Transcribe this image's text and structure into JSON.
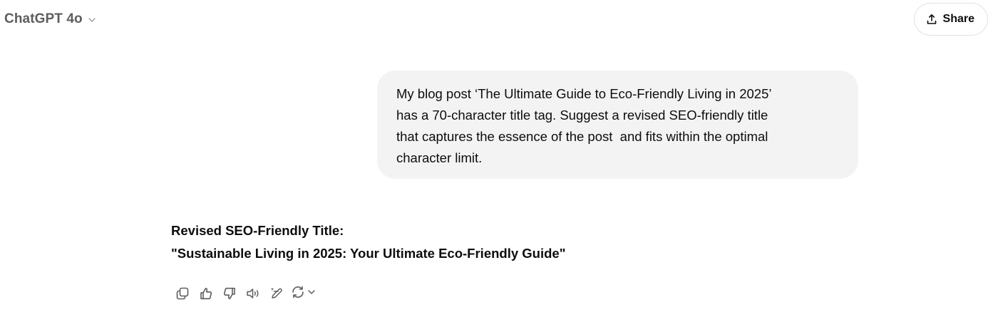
{
  "header": {
    "model_name": "ChatGPT 4o",
    "share_label": "Share"
  },
  "conversation": {
    "user_message": "My blog post ‘The Ultimate Guide to Eco-Friendly Living in 2025’\nhas a 70-character title tag. Suggest a revised SEO-friendly title\nthat captures the essence of the post  and fits within the optimal\ncharacter limit.",
    "assistant": {
      "heading": "Revised SEO-Friendly Title:",
      "title": "\"Sustainable Living in 2025: Your Ultimate Eco-Friendly Guide\""
    }
  },
  "actions": {
    "icons": [
      "copy-icon",
      "thumbs-up-icon",
      "thumbs-down-icon",
      "read-aloud-icon",
      "edit-canvas-icon",
      "regenerate-icon",
      "chevron-down-icon"
    ]
  },
  "colors": {
    "background": "#ffffff",
    "bubble": "#f3f3f3",
    "text": "#0d0d0d",
    "muted": "#5d5d5d",
    "icon": "#5d5d5d"
  }
}
